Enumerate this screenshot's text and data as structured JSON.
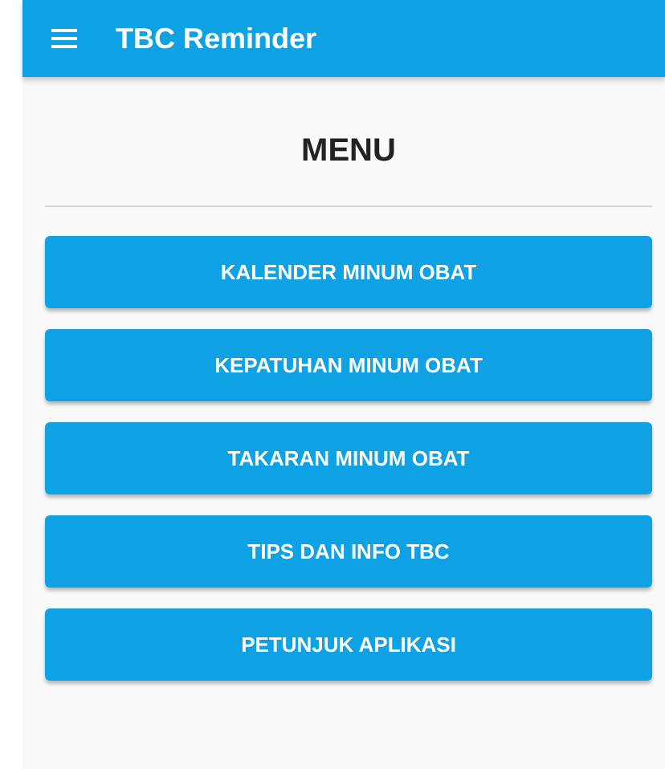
{
  "app_bar": {
    "title": "TBC Reminder"
  },
  "heading": "MENU",
  "menu_buttons": [
    {
      "label": "KALENDER MINUM OBAT"
    },
    {
      "label": "KEPATUHAN MINUM OBAT"
    },
    {
      "label": "TAKARAN MINUM OBAT"
    },
    {
      "label": "TIPS DAN INFO TBC"
    },
    {
      "label": "PETUNJUK APLIKASI"
    }
  ]
}
